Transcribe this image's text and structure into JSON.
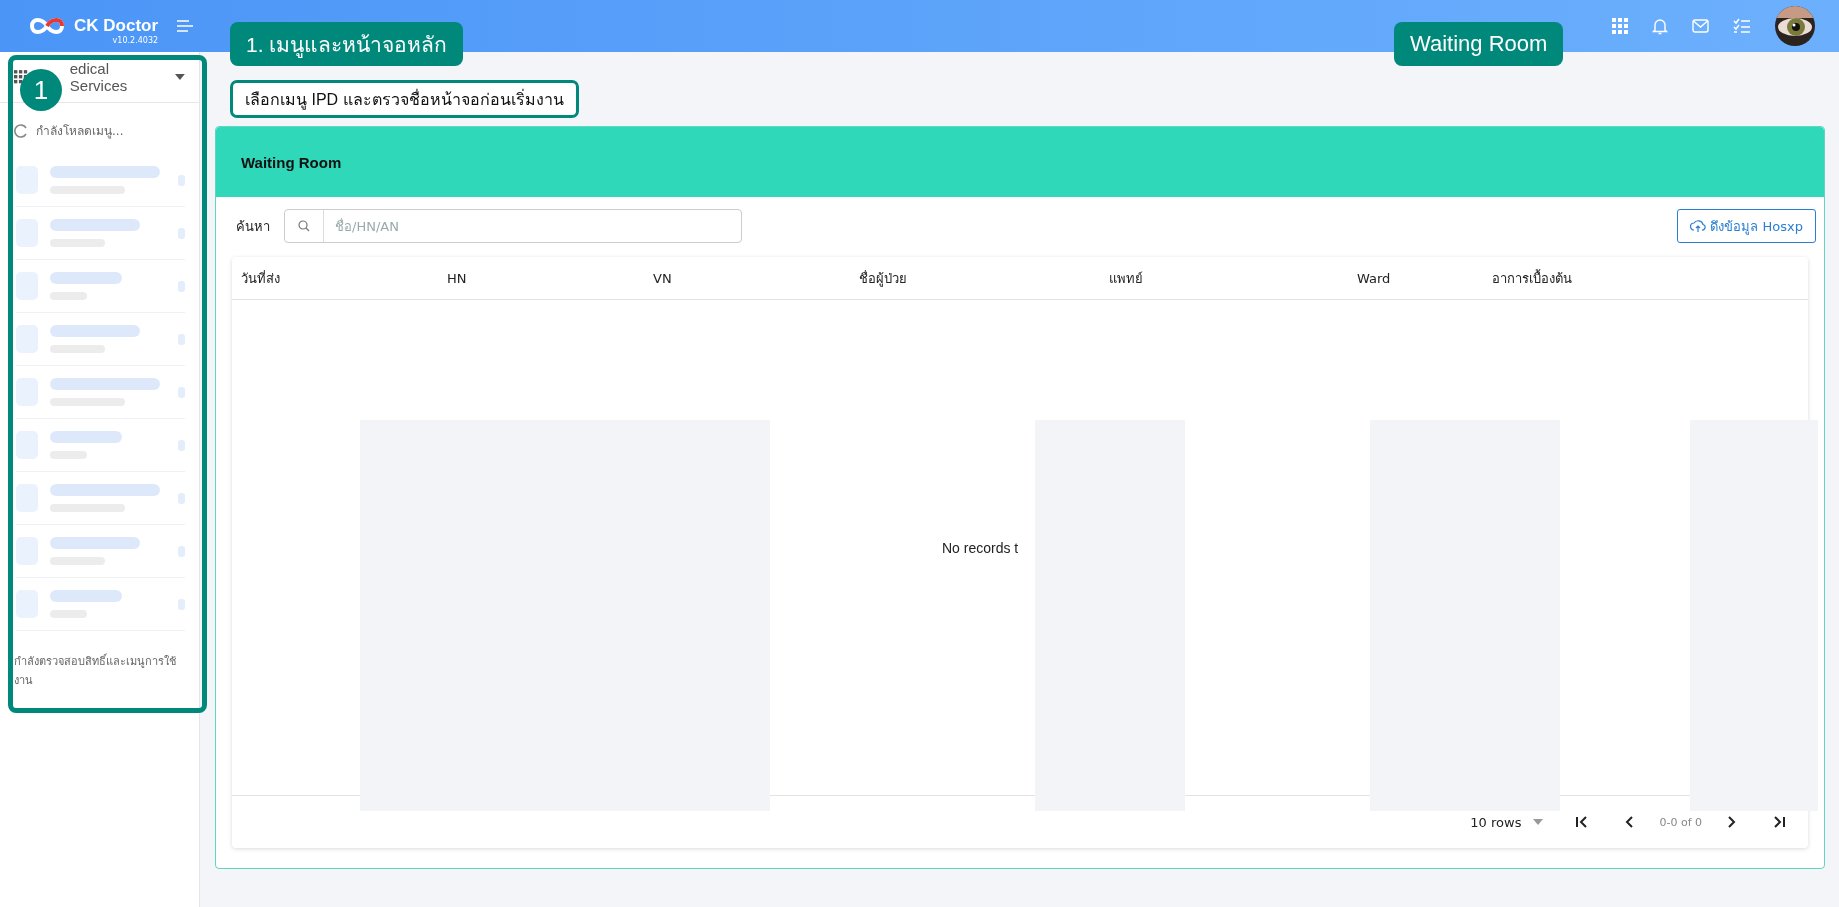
{
  "header": {
    "brand": "CK Doctor",
    "version": "v10.2.4032"
  },
  "annotations": {
    "step_badge": "1",
    "step_title": "1. เมนูและหน้าจอหลัก",
    "instruction": "เลือกเมนู IPD และตรวจชื่อหน้าจอก่อนเริ่มงาน",
    "screen_label": "Waiting Room"
  },
  "sidebar": {
    "module": "edical Services",
    "loading_text": "กำลังโหลดเมนู...",
    "status_text": "กำลังตรวจสอบสิทธิ์และเมนูการใช้งาน"
  },
  "card": {
    "title": "Waiting Room",
    "search": {
      "label": "ค้นหา",
      "placeholder": "ชื่อ/HN/AN"
    },
    "fetch_button": "ดึงข้อมูล Hosxp"
  },
  "table": {
    "columns": [
      "วันที่ส่ง",
      "HN",
      "VN",
      "ชื่อผู้ป่วย",
      "แพทย์",
      "Ward",
      "อาการเบื้องต้น"
    ],
    "empty_text": "No records t"
  },
  "pagination": {
    "rows_per_page": "10 rows",
    "range": "0-0 of 0"
  }
}
